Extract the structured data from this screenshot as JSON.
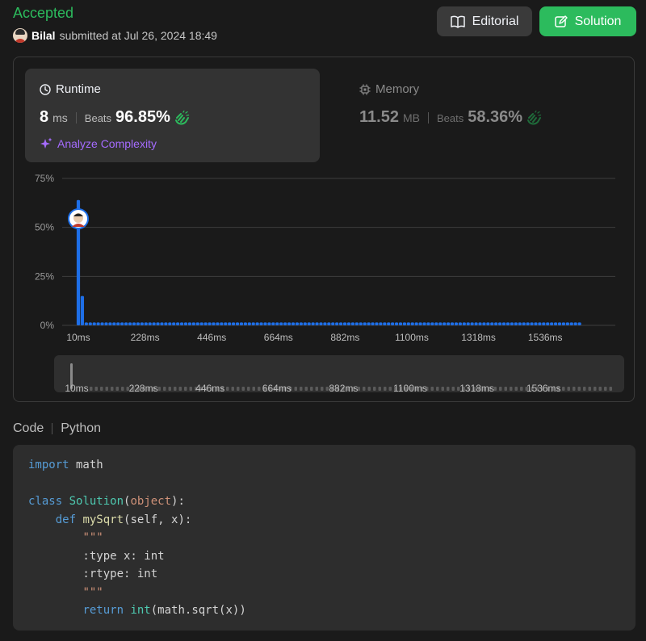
{
  "header": {
    "status": "Accepted",
    "user": "Bilal",
    "submitted_text": "submitted at Jul 26, 2024 18:49",
    "editorial_label": "Editorial",
    "solution_label": "Solution"
  },
  "runtime": {
    "title": "Runtime",
    "value": "8",
    "unit": "ms",
    "beats_label": "Beats",
    "beats_pct": "96.85%",
    "analyze_label": "Analyze Complexity"
  },
  "memory": {
    "title": "Memory",
    "value": "11.52",
    "unit": "MB",
    "beats_label": "Beats",
    "beats_pct": "58.36%"
  },
  "colors": {
    "accepted": "#2cbb5d",
    "bar": "#1e6fe8",
    "analyze": "#a56bff"
  },
  "chart_data": {
    "type": "bar",
    "y_ticks": [
      "75%",
      "50%",
      "25%",
      "0%"
    ],
    "ylim": [
      0,
      75
    ],
    "x_tick_labels": [
      "10ms",
      "228ms",
      "446ms",
      "664ms",
      "882ms",
      "1100ms",
      "1318ms",
      "1536ms"
    ],
    "bars": [
      {
        "x": 10,
        "y": 64
      },
      {
        "x": 23,
        "y": 15
      },
      {
        "x": 36,
        "y": 1.5
      }
    ],
    "baseline_bar_value": 1.5,
    "highlight_x": 10
  },
  "code": {
    "label": "Code",
    "language": "Python"
  }
}
